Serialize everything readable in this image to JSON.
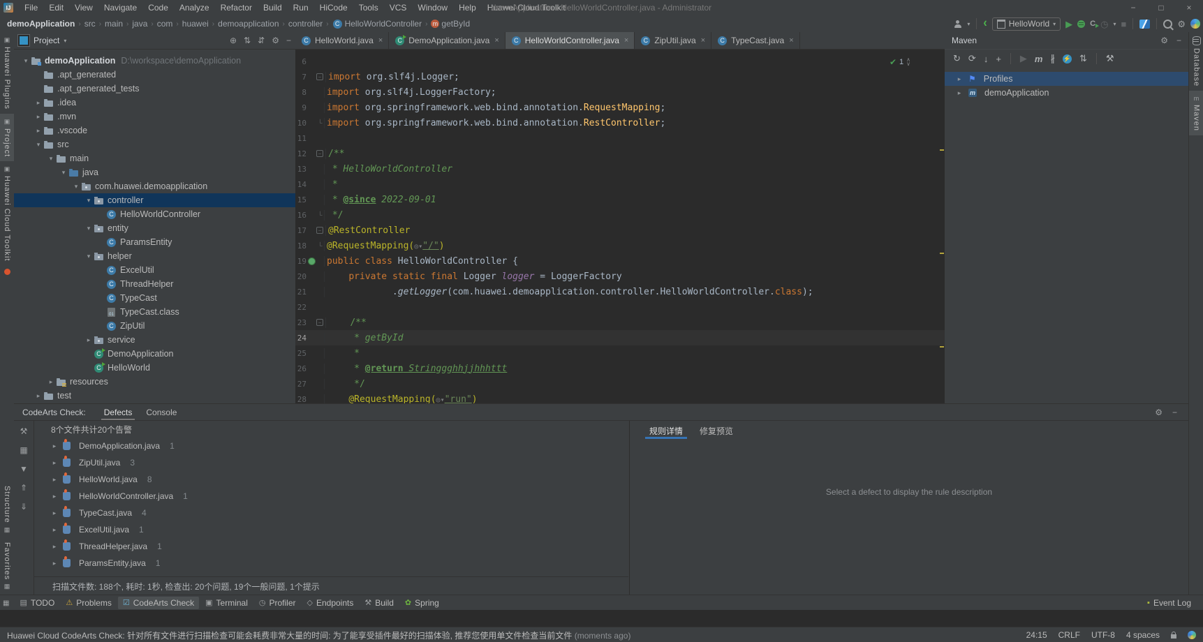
{
  "icons": {
    "logo": "IJ",
    "minimize": "−",
    "maximize": "□",
    "close": "×",
    "crumb_sep": "›",
    "gear": "⚙",
    "minus": "−",
    "plus": "+",
    "play": "▶",
    "stop": "■",
    "profiler": "◷",
    "caret": "▾",
    "locate": "⊕",
    "expand_all": "⇅",
    "collapse_all": "⇵",
    "maven_refresh": "↻",
    "maven_generate": "⟳",
    "maven_download": "↓",
    "maven_skip_tests": "∦",
    "maven_wrench": "⚒",
    "maven_goal": "m",
    "bolt": "⚡",
    "up": "∧",
    "down": "∨",
    "check": "✔",
    "rail_wrench": "⚒",
    "rail_group": "▦",
    "rail_filter": "▼",
    "rail_expand": "⇑",
    "rail_collapse": "⇓",
    "grip": "▦",
    "todo": "▤",
    "problems": "⚠",
    "codearts": "☑",
    "terminal": "▣",
    "profiler_tab": "◷",
    "endpoints": "◇",
    "build": "⚒",
    "spring": "✿",
    "eventlog": "▪"
  },
  "window": {
    "title": "demoApplication - HelloWorldController.java - Administrator",
    "menus": [
      "File",
      "Edit",
      "View",
      "Navigate",
      "Code",
      "Analyze",
      "Refactor",
      "Build",
      "Run",
      "HiCode",
      "Tools",
      "VCS",
      "Window",
      "Help",
      "Huawei Cloud Toolkit"
    ]
  },
  "toolbar": {
    "breadcrumbs": [
      {
        "label": "demoApplication"
      },
      {
        "label": "src"
      },
      {
        "label": "main"
      },
      {
        "label": "java"
      },
      {
        "label": "com"
      },
      {
        "label": "huawei"
      },
      {
        "label": "demoapplication"
      },
      {
        "label": "controller"
      },
      {
        "label": "HelloWorldController",
        "icon": "class"
      },
      {
        "label": "getById",
        "icon": "method"
      }
    ],
    "run_config": "HelloWorld"
  },
  "left_strip": {
    "top": [
      {
        "label": "Huawei Plugins",
        "active": false
      },
      {
        "label": "Project",
        "active": true
      },
      {
        "label": "Huawei Cloud Toolkit",
        "active": false
      }
    ],
    "bottom": [
      {
        "label": "Structure",
        "active": false
      },
      {
        "label": "Favorites",
        "active": false
      }
    ]
  },
  "right_strip": [
    {
      "label": "Database",
      "active": false
    },
    {
      "label": "Maven",
      "active": true
    }
  ],
  "project": {
    "title": "Project",
    "tree": [
      {
        "label": "demoApplication",
        "suffix": "D:\\workspace\\demoApplication",
        "lvl": 0,
        "icon": "folder-root",
        "arrow": "open",
        "bold": true
      },
      {
        "label": ".apt_generated",
        "lvl": 1,
        "icon": "folder",
        "arrow": null
      },
      {
        "label": ".apt_generated_tests",
        "lvl": 1,
        "icon": "folder",
        "arrow": null
      },
      {
        "label": ".idea",
        "lvl": 1,
        "icon": "folder",
        "arrow": "closed"
      },
      {
        "label": ".mvn",
        "lvl": 1,
        "icon": "folder",
        "arrow": "closed"
      },
      {
        "label": ".vscode",
        "lvl": 1,
        "icon": "folder",
        "arrow": "closed"
      },
      {
        "label": "src",
        "lvl": 1,
        "icon": "folder",
        "arrow": "open"
      },
      {
        "label": "main",
        "lvl": 2,
        "icon": "folder",
        "arrow": "open"
      },
      {
        "label": "java",
        "lvl": 3,
        "icon": "folder-src",
        "arrow": "open"
      },
      {
        "label": "com.huawei.demoapplication",
        "lvl": 4,
        "icon": "pkg",
        "arrow": "open"
      },
      {
        "label": "controller",
        "lvl": 5,
        "icon": "pkg",
        "arrow": "open",
        "selected": true
      },
      {
        "label": "HelloWorldController",
        "lvl": 6,
        "icon": "class",
        "arrow": null
      },
      {
        "label": "entity",
        "lvl": 5,
        "icon": "pkg",
        "arrow": "open"
      },
      {
        "label": "ParamsEntity",
        "lvl": 6,
        "icon": "class",
        "arrow": null
      },
      {
        "label": "helper",
        "lvl": 5,
        "icon": "pkg",
        "arrow": "open"
      },
      {
        "label": "ExcelUtil",
        "lvl": 6,
        "icon": "class",
        "arrow": null
      },
      {
        "label": "ThreadHelper",
        "lvl": 6,
        "icon": "class",
        "arrow": null
      },
      {
        "label": "TypeCast",
        "lvl": 6,
        "icon": "class",
        "arrow": null
      },
      {
        "label": "TypeCast.class",
        "lvl": 6,
        "icon": "classfile",
        "arrow": null
      },
      {
        "label": "ZipUtil",
        "lvl": 6,
        "icon": "class",
        "arrow": null
      },
      {
        "label": "service",
        "lvl": 5,
        "icon": "pkg",
        "arrow": "closed"
      },
      {
        "label": "DemoApplication",
        "lvl": 5,
        "icon": "class-run",
        "arrow": null
      },
      {
        "label": "HelloWorld",
        "lvl": 5,
        "icon": "class-run",
        "arrow": null
      },
      {
        "label": "resources",
        "lvl": 2,
        "icon": "folder-res",
        "arrow": "closed"
      },
      {
        "label": "test",
        "lvl": 1,
        "icon": "folder",
        "arrow": "closed"
      }
    ]
  },
  "editor": {
    "tabs": [
      {
        "label": "HelloWorld.java",
        "icon": "class",
        "active": false
      },
      {
        "label": "DemoApplication.java",
        "icon": "class-run",
        "active": false
      },
      {
        "label": "HelloWorldController.java",
        "icon": "class",
        "active": true
      },
      {
        "label": "ZipUtil.java",
        "icon": "class",
        "active": false
      },
      {
        "label": "TypeCast.java",
        "icon": "class",
        "active": false
      }
    ],
    "inspection_count": "1",
    "lines": [
      {
        "n": 6,
        "tokens": []
      },
      {
        "n": 7,
        "fold": "open",
        "tokens": [
          [
            "kw",
            "import"
          ],
          [
            "pl",
            " org.slf4j.Logger;"
          ]
        ]
      },
      {
        "n": 8,
        "tokens": [
          [
            "kw",
            "import"
          ],
          [
            "pl",
            " org.slf4j.LoggerFactory;"
          ]
        ]
      },
      {
        "n": 9,
        "tokens": [
          [
            "kw",
            "import"
          ],
          [
            "pl",
            " org.springframework.web.bind.annotation."
          ],
          [
            "cls",
            "RequestMapping"
          ],
          [
            "pl",
            ";"
          ]
        ]
      },
      {
        "n": 10,
        "fold": "end",
        "tokens": [
          [
            "kw",
            "import"
          ],
          [
            "pl",
            " org.springframework.web.bind.annotation."
          ],
          [
            "cls",
            "RestController"
          ],
          [
            "pl",
            ";"
          ]
        ]
      },
      {
        "n": 11,
        "tokens": []
      },
      {
        "n": 12,
        "fold": "open",
        "tokens": [
          [
            "cmt",
            "/**"
          ]
        ]
      },
      {
        "n": 13,
        "tokens": [
          [
            "cmt",
            " * "
          ],
          [
            "cmti",
            "HelloWorldController"
          ]
        ]
      },
      {
        "n": 14,
        "tokens": [
          [
            "cmt",
            " *"
          ]
        ]
      },
      {
        "n": 15,
        "tokens": [
          [
            "cmt",
            " * "
          ],
          [
            "tag",
            "@since"
          ],
          [
            "cmti",
            " 2022-09-01"
          ]
        ]
      },
      {
        "n": 16,
        "fold": "end",
        "tokens": [
          [
            "cmt",
            " */"
          ]
        ]
      },
      {
        "n": 17,
        "fold": "open",
        "tokens": [
          [
            "ann",
            "@RestController"
          ]
        ]
      },
      {
        "n": 18,
        "fold": "end",
        "tokens": [
          [
            "ann",
            "@RequestMapping("
          ],
          [
            "hint",
            "◎▾"
          ],
          [
            "stru",
            "\"/\""
          ],
          [
            "ann",
            ")"
          ]
        ]
      },
      {
        "n": 19,
        "gutter": "bean",
        "tokens": [
          [
            "kw",
            "public"
          ],
          [
            "pl",
            " "
          ],
          [
            "kw",
            "class"
          ],
          [
            "pl",
            " HelloWorldController {"
          ]
        ]
      },
      {
        "n": 20,
        "tokens": [
          [
            "pl",
            "    "
          ],
          [
            "kw",
            "private"
          ],
          [
            "pl",
            " "
          ],
          [
            "kw",
            "static"
          ],
          [
            "pl",
            " "
          ],
          [
            "kw",
            "final"
          ],
          [
            "pl",
            " Logger "
          ],
          [
            "fld",
            "logger"
          ],
          [
            "pl",
            " = LoggerFactory"
          ]
        ]
      },
      {
        "n": 21,
        "tokens": [
          [
            "pl",
            "            ."
          ],
          [
            "mth",
            "getLogger"
          ],
          [
            "pl",
            "(com.huawei.demoapplication.controller.HelloWorldController."
          ],
          [
            "kw",
            "class"
          ],
          [
            "pl",
            ");"
          ]
        ]
      },
      {
        "n": 22,
        "tokens": []
      },
      {
        "n": 23,
        "fold": "open",
        "tokens": [
          [
            "pl",
            "    "
          ],
          [
            "cmt",
            "/**"
          ]
        ]
      },
      {
        "n": 24,
        "current": true,
        "tokens": [
          [
            "pl",
            "    "
          ],
          [
            "cmt",
            " * "
          ],
          [
            "cmti",
            "getById"
          ]
        ]
      },
      {
        "n": 25,
        "tokens": [
          [
            "pl",
            "    "
          ],
          [
            "cmt",
            " *"
          ]
        ]
      },
      {
        "n": 26,
        "tokens": [
          [
            "pl",
            "    "
          ],
          [
            "cmt",
            " * "
          ],
          [
            "tag",
            "@return"
          ],
          [
            "cmtu",
            " Stringgghhjjhhhttt"
          ]
        ]
      },
      {
        "n": 27,
        "tokens": [
          [
            "pl",
            "    "
          ],
          [
            "cmt",
            " */"
          ]
        ]
      },
      {
        "n": 28,
        "tokens": [
          [
            "pl",
            "    "
          ],
          [
            "ann",
            "@RequestMapping("
          ],
          [
            "hint",
            "◎▾"
          ],
          [
            "stru",
            "\"run\""
          ],
          [
            "ann",
            ")"
          ]
        ]
      }
    ]
  },
  "maven": {
    "title": "Maven",
    "items": [
      {
        "label": "Profiles",
        "icon": "flag",
        "selected": true
      },
      {
        "label": "demoApplication",
        "icon": "maven",
        "selected": false
      }
    ]
  },
  "codearts": {
    "label": "CodeArts Check:",
    "tabs": [
      {
        "label": "Defects",
        "active": true
      },
      {
        "label": "Console",
        "active": false
      }
    ],
    "summary": "8个文件共计20个告警",
    "files": [
      {
        "name": "DemoApplication.java",
        "count": "1"
      },
      {
        "name": "ZipUtil.java",
        "count": "3"
      },
      {
        "name": "HelloWorld.java",
        "count": "8"
      },
      {
        "name": "HelloWorldController.java",
        "count": "1"
      },
      {
        "name": "TypeCast.java",
        "count": "4"
      },
      {
        "name": "ExcelUtil.java",
        "count": "1"
      },
      {
        "name": "ThreadHelper.java",
        "count": "1"
      },
      {
        "name": "ParamsEntity.java",
        "count": "1"
      }
    ],
    "footer": "扫描文件数: 188个, 耗时: 1秒, 检查出: 20个问题, 19个一般问题, 1个提示",
    "detail_tabs": [
      {
        "label": "规则详情",
        "active": true
      },
      {
        "label": "修复预览",
        "active": false
      }
    ],
    "placeholder": "Select a defect to display the rule description"
  },
  "status": {
    "buttons": [
      {
        "label": "TODO",
        "icon": "todo",
        "active": false
      },
      {
        "label": "Problems",
        "icon": "problems",
        "active": false
      },
      {
        "label": "CodeArts Check",
        "icon": "codearts",
        "active": true
      },
      {
        "label": "Terminal",
        "icon": "terminal",
        "active": false
      },
      {
        "label": "Profiler",
        "icon": "profiler_tab",
        "active": false
      },
      {
        "label": "Endpoints",
        "icon": "endpoints",
        "active": false
      },
      {
        "label": "Build",
        "icon": "build",
        "active": false
      },
      {
        "label": "Spring",
        "icon": "spring",
        "active": false
      }
    ],
    "event_log": "Event Log",
    "message": "Huawei Cloud CodeArts Check: 针对所有文件进行扫描检查可能会耗费非常大量的时间: 为了能享受插件最好的扫描体验, 推荐您使用单文件检查当前文件",
    "message_ago": " (moments ago)",
    "caret": "24:15",
    "line_ending": "CRLF",
    "encoding": "UTF-8",
    "indent": "4 spaces"
  }
}
